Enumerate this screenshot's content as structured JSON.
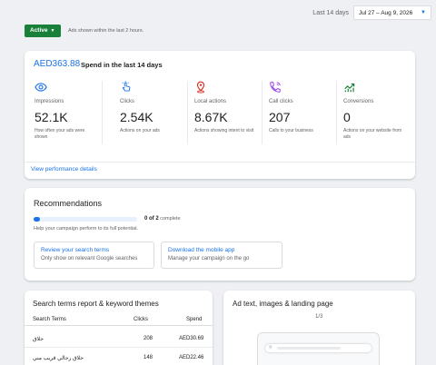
{
  "header": {
    "date_label": "Last 14 days",
    "date_range": "Jul 27 – Aug 9, 2026",
    "status_label": "Active",
    "status_note": "Ads shown within the last 2 hours."
  },
  "spend": {
    "amount": "AED363.88",
    "text": "Spend in the last 14 days",
    "link": "View performance details",
    "metrics": [
      {
        "icon": "eye-icon",
        "label": "Impressions",
        "value": "52.1K",
        "desc": "How often your ads were shown"
      },
      {
        "icon": "click-icon",
        "label": "Clicks",
        "value": "2.54K",
        "desc": "Actions on your ads"
      },
      {
        "icon": "location-pin-icon",
        "label": "Local actions",
        "value": "8.67K",
        "desc": "Actions showing intent to visit"
      },
      {
        "icon": "phone-icon",
        "label": "Call clicks",
        "value": "207",
        "desc": "Calls to your business"
      },
      {
        "icon": "trend-icon",
        "label": "Conversions",
        "value": "0",
        "desc": "Actions on your website from ads"
      }
    ]
  },
  "recommendations": {
    "title": "Recommendations",
    "progress_text": "0 of 2",
    "progress_suffix": "complete",
    "progress_fraction": 0.06,
    "help": "Help your campaign perform to its full potential.",
    "items": [
      {
        "title": "Review your search terms",
        "subtitle": "Only show on relevant Google searches"
      },
      {
        "title": "Download the mobile app",
        "subtitle": "Manage your campaign on the go"
      }
    ]
  },
  "search_terms": {
    "title": "Search terms report & keyword themes",
    "headers": {
      "term": "Search Terms",
      "clicks": "Clicks",
      "spend": "Spend"
    },
    "rows": [
      {
        "term": "حلاق",
        "clicks": "208",
        "spend": "AED30.69"
      },
      {
        "term": "حلاق رجالي قريب مني",
        "clicks": "148",
        "spend": "AED22.46"
      }
    ]
  },
  "ad_preview": {
    "title": "Ad text, images & landing page",
    "page": "1/3"
  },
  "colors": {
    "accent": "#1a73e8",
    "active_green": "#188038",
    "eye_icon": "#1a73e8",
    "click_icon": "#1a73e8",
    "pin_icon": "#d93025",
    "phone_icon": "#9334e6",
    "trend_icon": "#188038"
  }
}
